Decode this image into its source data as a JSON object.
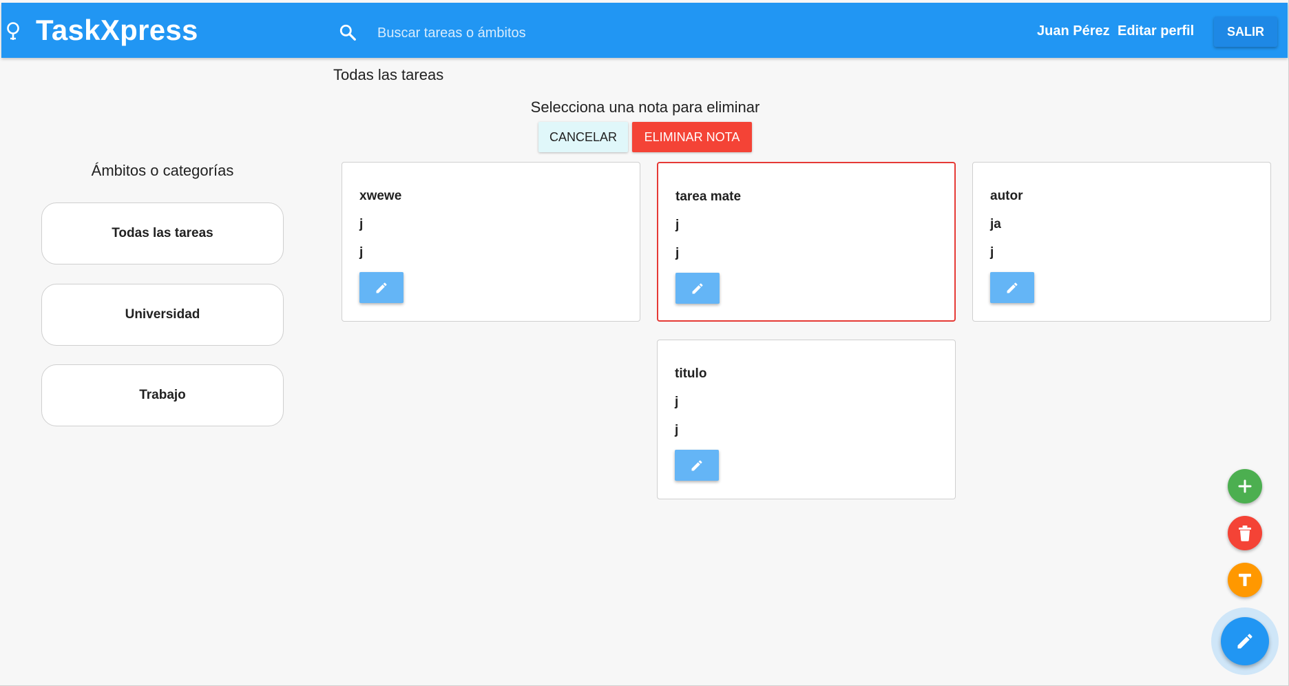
{
  "header": {
    "title": "TaskXpress",
    "search_placeholder": "Buscar tareas o ámbitos",
    "search_value": "",
    "user_name": "Juan Pérez",
    "edit_profile_label": "Editar perfil",
    "logout_label": "SALIR"
  },
  "main": {
    "section_title": "Todas las tareas",
    "delete_prompt": "Selecciona una nota para eliminar",
    "cancel_label": "CANCELAR",
    "delete_note_label": "ELIMINAR NOTA"
  },
  "sidebar": {
    "title": "Ámbitos o categorías",
    "items": [
      {
        "label": "Todas las tareas"
      },
      {
        "label": "Universidad"
      },
      {
        "label": "Trabajo"
      }
    ]
  },
  "notes": [
    {
      "title": "xwewe",
      "line1": "j",
      "line2": "j",
      "selected": false
    },
    {
      "title": "tarea mate",
      "line1": "j",
      "line2": "j",
      "selected": true
    },
    {
      "title": "autor",
      "line1": "ja",
      "line2": "j",
      "selected": false
    },
    {
      "title": "titulo",
      "line1": "j",
      "line2": "j",
      "selected": false
    }
  ],
  "fabs": {
    "add_icon": "plus-icon",
    "delete_icon": "trash-icon",
    "text_icon": "text-t-icon",
    "main_icon": "pencil-icon"
  },
  "colors": {
    "primary": "#2196f3",
    "selected_border": "#e53935",
    "delete": "#f44336",
    "add": "#4caf50",
    "text": "#ff9800",
    "edit_button": "#64b5f6",
    "cancel_bg": "#e0f7fa"
  }
}
